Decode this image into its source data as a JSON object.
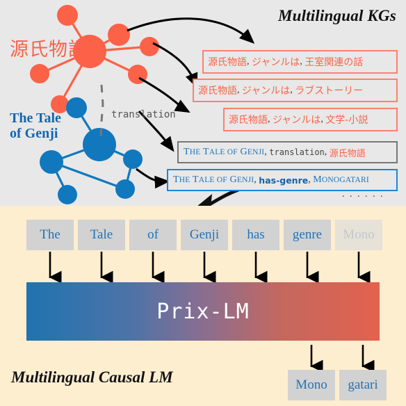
{
  "kg": {
    "title": "Multilingual KGs",
    "entity_ja": "源氏物語",
    "entity_en_line1": "The Tale",
    "entity_en_line2": "of Genji",
    "translation_label": "translation",
    "ellipsis": ". . . . . .",
    "triples": [
      {
        "name": "triple-royal-tale",
        "style": "red",
        "head": "源氏物語",
        "relation": "ジャンルは",
        "tail": "王室関連の話",
        "text": "源氏物語, ジャンルは, 王室関連の話"
      },
      {
        "name": "triple-love-story",
        "style": "red",
        "head": "源氏物語",
        "relation": "ジャンルは",
        "tail": "ラブストーリー",
        "text": "源氏物語, ジャンルは, ラブストーリー"
      },
      {
        "name": "triple-literary-novel",
        "style": "red",
        "head": "源氏物語",
        "relation": "ジャンルは",
        "tail": "文学-小説",
        "text": "源氏物語, ジャンルは, 文学-小説"
      },
      {
        "name": "triple-translation",
        "style": "gray",
        "head": "The Tale of Genji",
        "relation": "translation",
        "tail": "源氏物語",
        "text": "The Tale of Genji, translation, 源氏物語"
      },
      {
        "name": "triple-has-genre",
        "style": "blue",
        "head": "The Tale of Genji",
        "relation": "has-genre",
        "tail": "Monogatari",
        "text": "The Tale of Genji, has-genre, Monogatari"
      }
    ],
    "colors": {
      "red_node": "#fb6248",
      "blue_node": "#1178be",
      "panel_bg": "#e8e8e8",
      "red_border": "#fb8070",
      "gray_border": "#777777",
      "blue_border": "#1c86d4"
    }
  },
  "lm": {
    "title": "Multilingual Causal LM",
    "model_name": "Prix-LM",
    "input_tokens": [
      {
        "label": "The",
        "faded": false
      },
      {
        "label": "Tale",
        "faded": false
      },
      {
        "label": "of",
        "faded": false
      },
      {
        "label": "Genji",
        "faded": false
      },
      {
        "label": "has",
        "faded": false
      },
      {
        "label": "genre",
        "faded": false
      },
      {
        "label": "Mono",
        "faded": true
      }
    ],
    "output_tokens": [
      {
        "label": "Mono"
      },
      {
        "label": "gatari"
      }
    ],
    "colors": {
      "panel_bg": "#fdeed0",
      "token_bg": "#d2d2d2",
      "token_text": "#1f72b8",
      "gradient_start": "#1f73b0",
      "gradient_end": "#e4614d"
    }
  }
}
